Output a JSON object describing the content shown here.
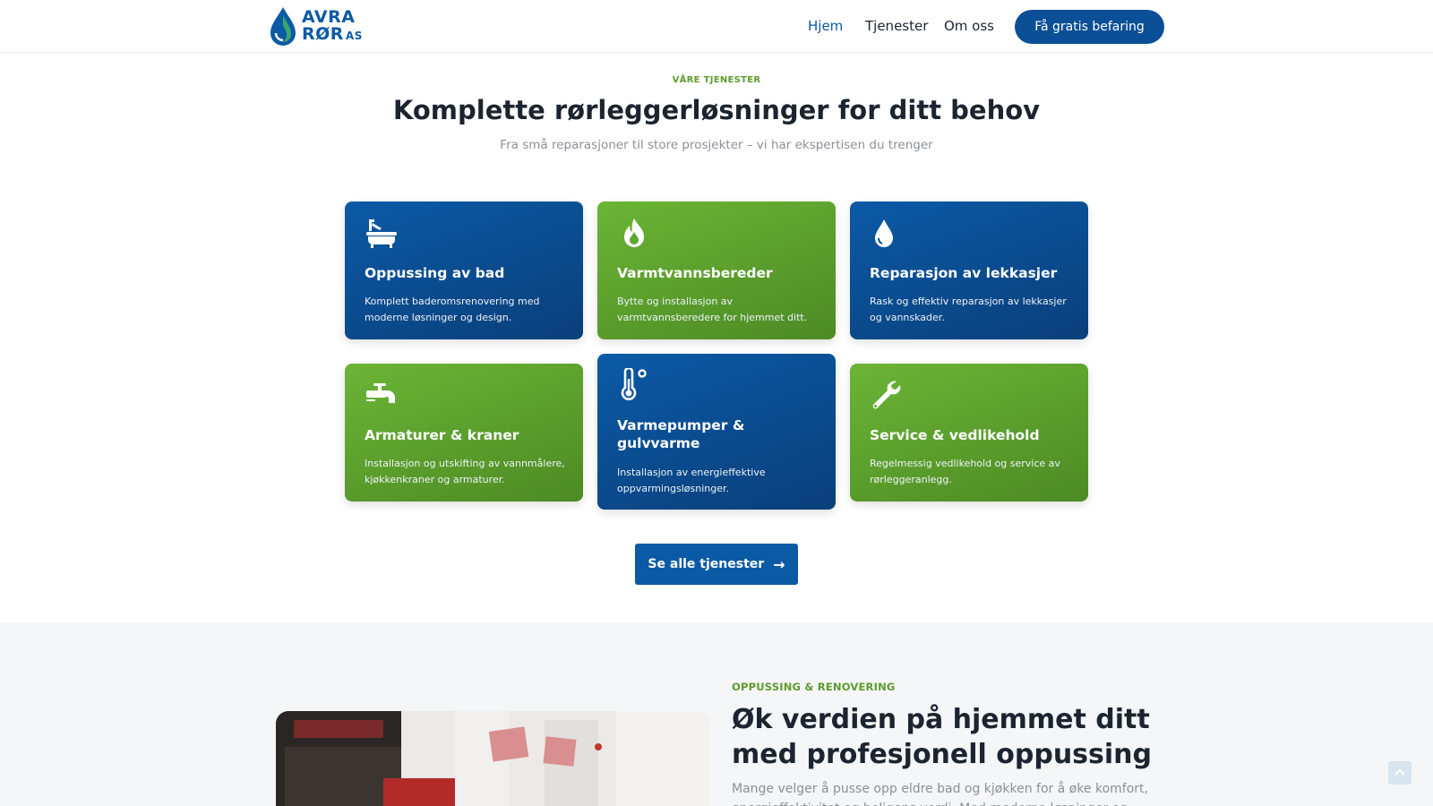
{
  "logo": {
    "line1": "AVRA",
    "line2": "RØR",
    "suffix": "AS"
  },
  "nav": {
    "items": [
      {
        "label": "Hjem",
        "active": true
      },
      {
        "label": "Tjenester",
        "active": false
      },
      {
        "label": "Om oss",
        "active": false
      }
    ],
    "cta_label": "Få gratis befaring"
  },
  "services": {
    "eyebrow": "VÅRE TJENESTER",
    "title": "Komplette rørleggerløsninger for ditt behov",
    "subtitle": "Fra små reparasjoner til store prosjekter – vi har ekspertisen du trenger",
    "cards": [
      {
        "title": "Oppussing av bad",
        "desc": "Komplett baderomsrenovering med moderne løsninger og design.",
        "icon": "bathtub-icon",
        "color": "blue"
      },
      {
        "title": "Varmtvannsbereder",
        "desc": "Bytte og installasjon av varmtvannsberedere for hjemmet ditt.",
        "icon": "fire-icon",
        "color": "green"
      },
      {
        "title": "Reparasjon av lekkasjer",
        "desc": "Rask og effektiv reparasjon av lekkasjer og vannskader.",
        "icon": "water-drop-icon",
        "color": "blue"
      },
      {
        "title": "Armaturer & kraner",
        "desc": "Installasjon og utskifting av vannmålere, kjøkkenkraner og armaturer.",
        "icon": "faucet-icon",
        "color": "green"
      },
      {
        "title": "Varmepumper & gulvvarme",
        "desc": "Installasjon av energieffektive oppvarmingsløsninger.",
        "icon": "thermometer-icon",
        "color": "blue"
      },
      {
        "title": "Service & vedlikehold",
        "desc": "Regelmessig vedlikehold og service av rørleggeranlegg.",
        "icon": "wrench-icon",
        "color": "green"
      }
    ],
    "all_button_label": "Se alle tjenester"
  },
  "renovation": {
    "eyebrow": "OPPUSSING & RENOVERING",
    "title": "Øk verdien på hjemmet ditt med profesjonell oppussing",
    "text": "Mange velger å pusse opp eldre bad og kjøkken for å øke komfort, energieffektivitet og boligens verdi. Med moderne løsninger og faglig"
  },
  "colors": {
    "brand_blue": "#0b5aa6",
    "brand_green": "#5e9b2c"
  }
}
